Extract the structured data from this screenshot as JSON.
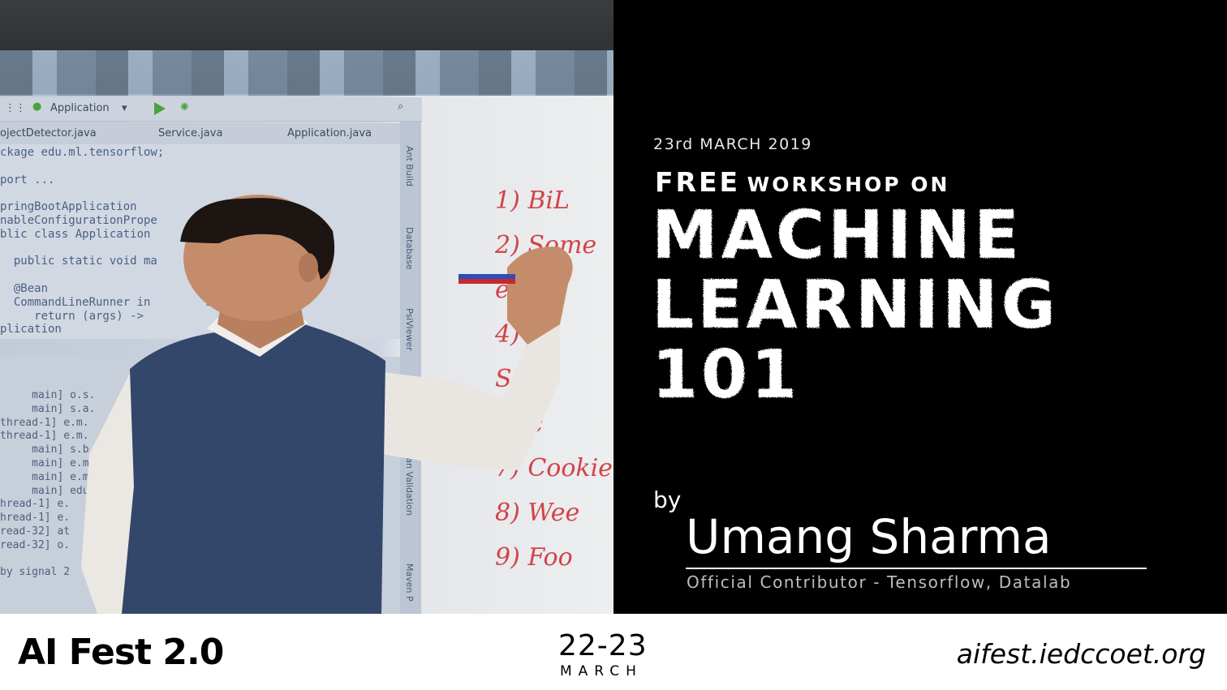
{
  "photo": {
    "ide": {
      "toolbar_label": "Application",
      "tabs": [
        "ojectDetector.java",
        "Service.java",
        "Application.java"
      ],
      "code_lines": [
        "ckage edu.ml.tensorflow;",
        "",
        "port ...",
        "",
        "pringBootApplication",
        "nableConfigurationPrope          erties.c",
        "blic class Application",
        "",
        "  public static void ma         SpringA",
        "",
        "  @Bean",
        "  CommandLineRunner in        storageSer",
        "     return (args) ->",
        "plication"
      ],
      "console_lines": [
        "     main] o.s.",
        "     main] s.a.",
        "thread-1] e.m.",
        "thread-1] e.m.",
        "     main] s.b.",
        "     main] e.m",
        "     main] e.m",
        "     main] edu",
        "hread-1] e.",
        "hread-1] e.",
        "read-32] at",
        "read-32] o.",
        "",
        "by signal 2"
      ],
      "side_panel": [
        "Ant Build",
        "Database",
        "PsiViewer",
        "Bean Validation",
        "Maven P"
      ]
    },
    "whiteboard_notes": [
      "1) BiL",
      "2) Some",
      "    e",
      "4) Se",
      "   S",
      "  Clic",
      "7) Cookie",
      "8) Wee",
      "9) Foo"
    ]
  },
  "workshop": {
    "date": "23rd MARCH 2019",
    "free": "FREE",
    "subtitle": "WORKSHOP ON",
    "title_lines": [
      "MACHINE",
      "LEARNING",
      "101"
    ],
    "by": "by",
    "speaker_name": "Umang Sharma",
    "speaker_role": "Official Contributor - Tensorflow, Datalab"
  },
  "footer": {
    "event_name": "AI Fest 2.0",
    "dates": "22-23",
    "month": "MARCH",
    "url": "aifest.iedccoet.org"
  },
  "colors": {
    "background": "#000000",
    "footer_background": "#ffffff",
    "text_primary": "#ffffff",
    "text_secondary": "#bdbdbd",
    "marker_red": "#d4424a"
  }
}
